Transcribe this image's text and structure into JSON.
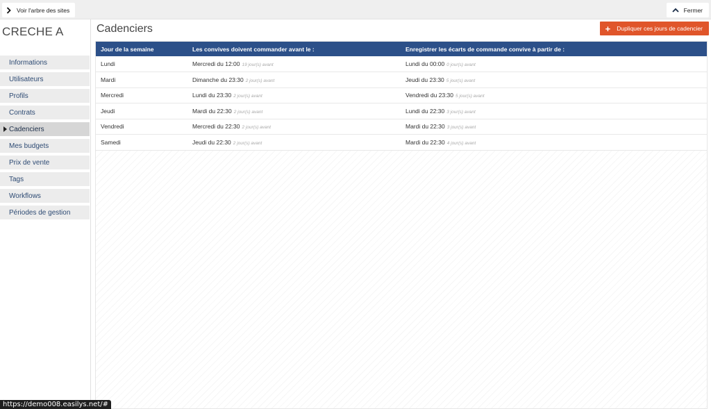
{
  "topbar": {
    "tree_label": "Voir l'arbre des sites",
    "close_label": "Fermer"
  },
  "sidebar": {
    "site_name": "CRECHE A",
    "items": [
      {
        "label": "Informations",
        "active": false
      },
      {
        "label": "Utilisateurs",
        "active": false
      },
      {
        "label": "Profils",
        "active": false
      },
      {
        "label": "Contrats",
        "active": false
      },
      {
        "label": "Cadenciers",
        "active": true
      },
      {
        "label": "Mes budgets",
        "active": false
      },
      {
        "label": "Prix de vente",
        "active": false
      },
      {
        "label": "Tags",
        "active": false
      },
      {
        "label": "Workflows",
        "active": false
      },
      {
        "label": "Périodes de gestion",
        "active": false
      }
    ]
  },
  "main": {
    "title": "Cadenciers",
    "duplicate_label": "Dupliquer ces jours de cadencier",
    "accent_color": "#e0552a",
    "header_color": "#2c5089",
    "table": {
      "headers": [
        "Jour de la semaine",
        "Les convives doivent commander avant le :",
        "Enregistrer les écarts de commande convive à partir de :"
      ],
      "rows": [
        {
          "day": "Lundi",
          "order": "Mercredi du 12:00",
          "order_note": "19 jour(s) avant",
          "record": "Lundi du 00:00",
          "record_note": "0 jour(s) avant"
        },
        {
          "day": "Mardi",
          "order": "Dimanche du 23:30",
          "order_note": "2 jour(s) avant",
          "record": "Jeudi du 23:30",
          "record_note": "5 jour(s) avant"
        },
        {
          "day": "Mercredi",
          "order": "Lundi du 23:30",
          "order_note": "2 jour(s) avant",
          "record": "Vendredi du 23:30",
          "record_note": "5 jour(s) avant"
        },
        {
          "day": "Jeudi",
          "order": "Mardi du 22:30",
          "order_note": "2 jour(s) avant",
          "record": "Lundi du 22:30",
          "record_note": "3 jour(s) avant"
        },
        {
          "day": "Vendredi",
          "order": "Mercredi du 22:30",
          "order_note": "2 jour(s) avant",
          "record": "Mardi du 22:30",
          "record_note": "3 jour(s) avant"
        },
        {
          "day": "Samedi",
          "order": "Jeudi du 22:30",
          "order_note": "2 jour(s) avant",
          "record": "Mardi du 22:30",
          "record_note": "4 jour(s) avant"
        }
      ]
    }
  },
  "status_url": "https://demo008.easilys.net/#"
}
